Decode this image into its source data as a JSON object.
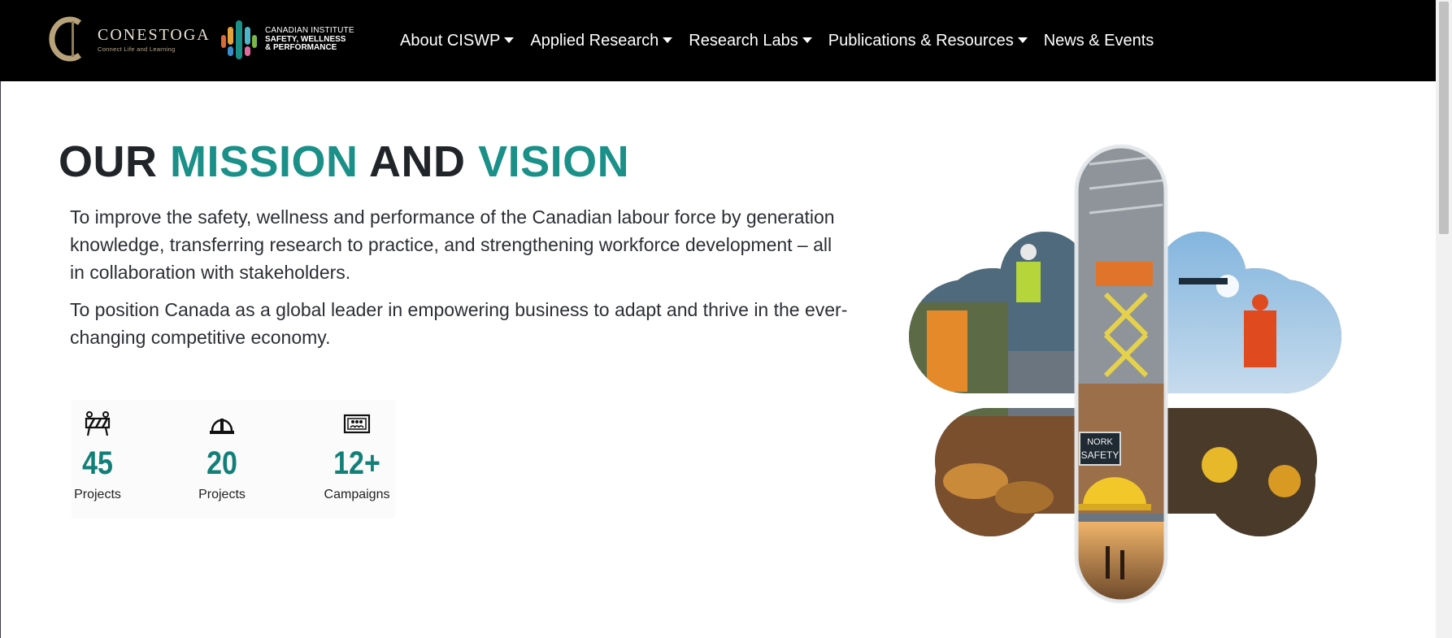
{
  "navbar": {
    "conestoga": {
      "name": "CONESTOGA",
      "tagline": "Connect Life and Learning"
    },
    "ciswp": {
      "line1": "CANADIAN INSTITUTE",
      "line2": "SAFETY, WELLNESS",
      "line3": "& PERFORMANCE"
    },
    "items": [
      {
        "label": "About CISWP",
        "dropdown": true
      },
      {
        "label": "Applied Research",
        "dropdown": true
      },
      {
        "label": "Research Labs",
        "dropdown": true
      },
      {
        "label": "Publications & Resources",
        "dropdown": true
      },
      {
        "label": "News & Events",
        "dropdown": false
      }
    ]
  },
  "hero": {
    "title_parts": [
      "OUR",
      "MISSION",
      "AND",
      "VISION"
    ],
    "mission": "To improve the safety, wellness and performance of the Canadian labour force by generation knowledge, transferring research to practice, and strengthening workforce development – all in collaboration with stakeholders.",
    "vision": "To position Canada as a global leader in empowering business to adapt and thrive in the ever-changing competitive economy."
  },
  "stats": [
    {
      "icon": "barrier-icon",
      "value": "45",
      "label": "Projects"
    },
    {
      "icon": "hard-hat-icon",
      "value": "20",
      "label": "Projects"
    },
    {
      "icon": "campaign-board-icon",
      "value": "12+",
      "label": "Campaigns"
    }
  ],
  "collage": {
    "sign_text_1": "NORK",
    "sign_text_2": "SAFETY"
  },
  "colors": {
    "nav_bg": "#000000",
    "accent_teal": "#1a9088",
    "stat_teal": "#127f78",
    "text_dark": "#212529"
  }
}
